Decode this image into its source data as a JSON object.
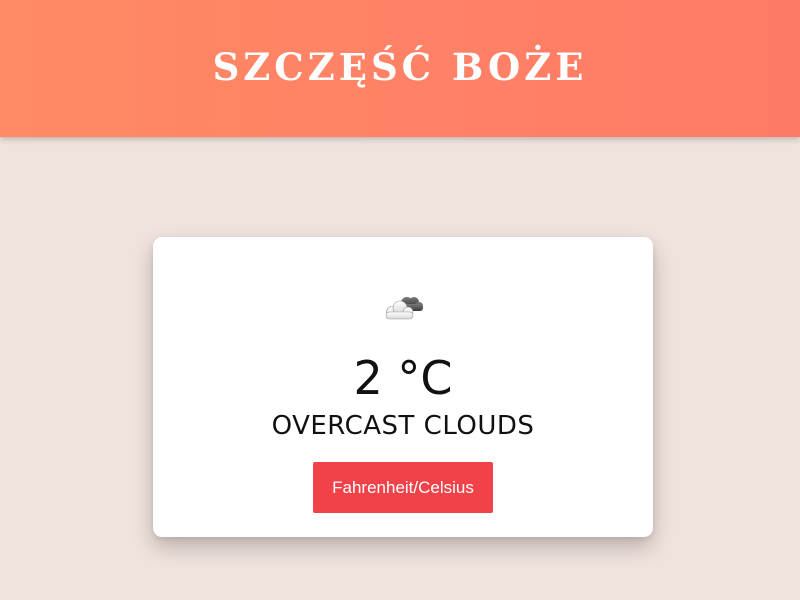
{
  "header": {
    "title": "SZCZĘŚĆ BOŻE"
  },
  "weather": {
    "icon": "cloud-icon",
    "temperature": "2 °C",
    "description": "OVERCAST CLOUDS"
  },
  "controls": {
    "toggle_label": "Fahrenheit/Celsius"
  },
  "colors": {
    "header_start": "#ff8a65",
    "header_end": "#ff7a66",
    "background": "#f0e2dc",
    "button": "#f24249"
  }
}
